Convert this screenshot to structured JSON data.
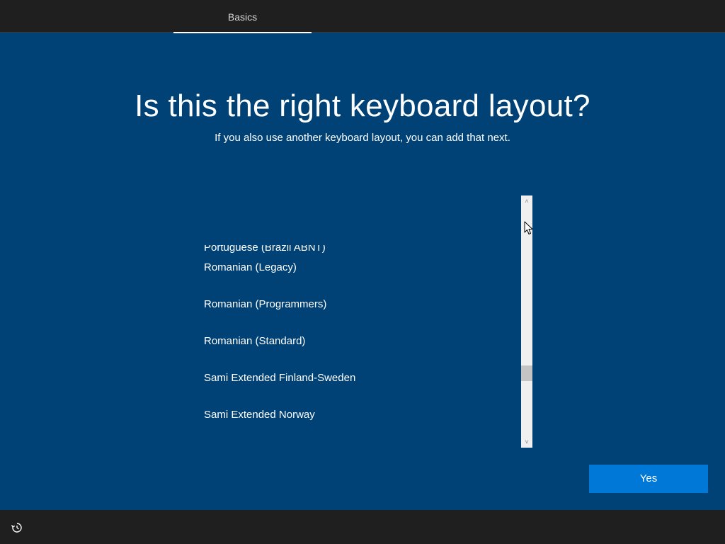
{
  "header": {
    "tabs": [
      {
        "label": "Basics",
        "active": true
      }
    ]
  },
  "main": {
    "title": "Is this the right keyboard layout?",
    "subtitle": "If you also use another keyboard layout, you can add that next.",
    "keyboard_layouts": [
      "Portuguese (Brazil ABNT)",
      "Romanian (Legacy)",
      "Romanian (Programmers)",
      "Romanian (Standard)",
      "Sami Extended Finland-Sweden",
      "Sami Extended Norway"
    ],
    "yes_button_label": "Yes"
  },
  "scrollbar": {
    "up_glyph": "˄",
    "down_glyph": "˅"
  },
  "footer": {
    "ease_of_access_icon": "ease-of-access-icon"
  },
  "colors": {
    "background": "#004275",
    "chrome": "#1f1f1f",
    "accent": "#0078d7"
  }
}
